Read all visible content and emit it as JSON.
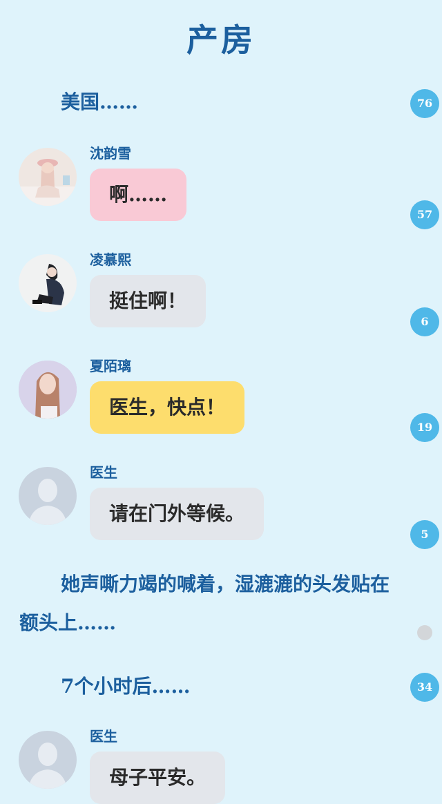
{
  "page": {
    "title": "产房"
  },
  "narration": {
    "line1": "美国……",
    "paragraph": "她声嘶力竭的喊着，湿漉漉的头发贴在额头上……",
    "line2": "7个小时后……"
  },
  "badges": {
    "b1": "76",
    "b2": "57",
    "b3": "6",
    "b4": "19",
    "b5": "5",
    "b6": "34"
  },
  "messages": [
    {
      "name": "沈韵雪",
      "text": "啊……",
      "bubble_color": "#f9c9d5"
    },
    {
      "name": "凌慕熙",
      "text": "挺住啊！",
      "bubble_color": "#e3e6eb"
    },
    {
      "name": "夏陌璃",
      "text": "医生，快点！",
      "bubble_color": "#fddd6d"
    },
    {
      "name": "医生",
      "text": "请在门外等候。",
      "bubble_color": "#e3e6eb"
    },
    {
      "name": "医生",
      "text": "母子平安。",
      "bubble_color": "#e3e6eb"
    }
  ],
  "colors": {
    "background": "#dff3fb",
    "heading": "#1c5f9e",
    "badge": "#4fb8e8"
  }
}
